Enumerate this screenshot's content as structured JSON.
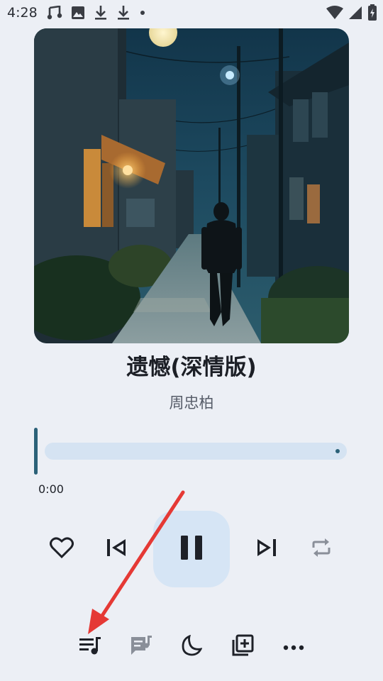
{
  "status_bar": {
    "time": "4:28",
    "left_icons": [
      "music-note-icon",
      "image-icon",
      "download-icon",
      "download-icon",
      "dot-icon"
    ],
    "right_icons": [
      "wifi-icon",
      "signal-icon",
      "battery-charging-icon"
    ]
  },
  "player": {
    "album_art": "night-street-with-walking-man",
    "title": "遗憾(深情版)",
    "artist": "周忠柏",
    "current_time": "0:00",
    "progress": 0.0
  },
  "controls": {
    "favorite_icon": "heart-outline-icon",
    "previous_icon": "skip-previous-icon",
    "play_pause_icon": "pause-icon",
    "next_icon": "skip-next-icon",
    "repeat_icon": "repeat-icon"
  },
  "toolbar": {
    "items": [
      "queue-music-icon",
      "lyrics-icon",
      "sleep-timer-icon",
      "add-to-playlist-icon",
      "more-icon"
    ]
  },
  "colors": {
    "background": "#eceff5",
    "accent": "#2b6178",
    "track": "#d5e3f2",
    "play_button_bg": "#d6e5f5",
    "annotation_arrow": "#e53935"
  }
}
